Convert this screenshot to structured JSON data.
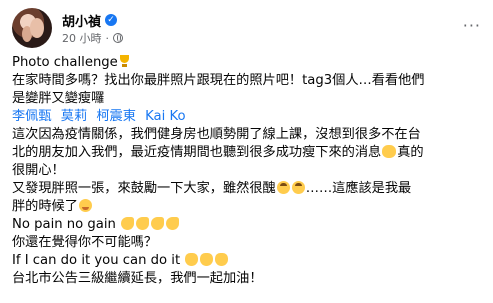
{
  "post": {
    "author": "胡小禎",
    "time": "20 小時",
    "time_sep": "·",
    "more": "···",
    "verified": "✓"
  },
  "content": {
    "line1": "Photo challenge",
    "line2": "在家時間多嗎？找出你最胖照片跟現在的照片吧！tag3個人…看看他們",
    "line3": "是變胖又變瘦囉",
    "tags": [
      "李佩甄",
      "莫莉",
      "柯震東",
      "Kai Ko"
    ],
    "line5": "這次因為疫情關係，我們健身房也順勢開了線上課，沒想到很多不在台",
    "line6": "北的朋友加入我們，最近疫情期間也聽到很多成功瘦下來的消息",
    "line6_end": "真的",
    "line7": "很開心！",
    "line8a": "又發現胖照一張，來鼓勵一下大家，雖然很醜",
    "line8b": "……這應該是我最",
    "line9": "胖的時候了",
    "line10": "No pain no gain",
    "line11": "你還在覺得你不可能嗎？",
    "line12": "If I can do it you can do it",
    "line13": "台北市公告三級繼續延長，我們一起加油！"
  },
  "icons": {
    "verified": "verified-badge-icon",
    "globe": "globe-icon",
    "more": "more-icon",
    "trophy": "trophy-icon",
    "muscle": "flexed-biceps-icon",
    "clap": "clapping-hands-icon",
    "upside": "upside-down-face-icon",
    "smile": "smiling-face-icon",
    "hands": "raising-hands-icon"
  },
  "colors": {
    "link": "#1877f2",
    "meta": "#65676b",
    "text": "#050505"
  }
}
